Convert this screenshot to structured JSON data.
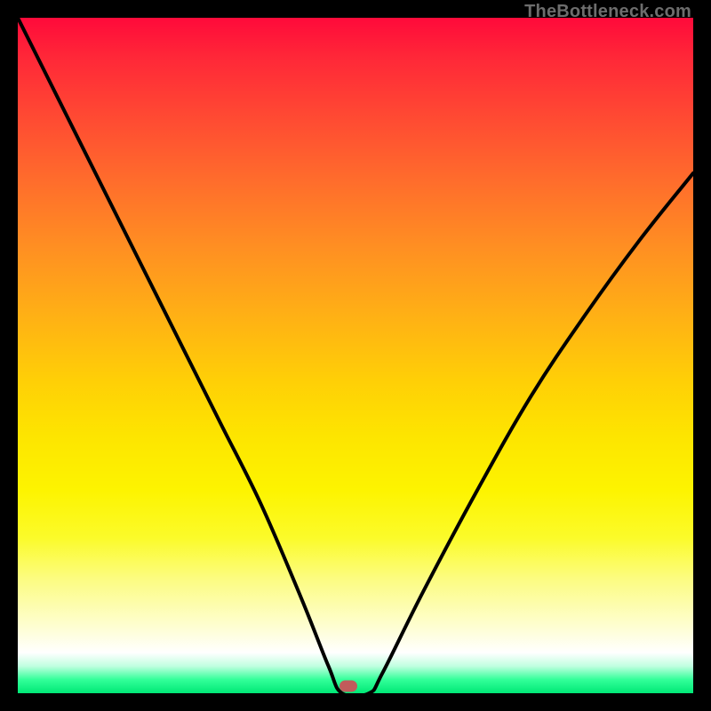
{
  "watermark": "TheBottleneck.com",
  "chart_data": {
    "type": "line",
    "title": "",
    "xlabel": "",
    "ylabel": "",
    "xlim": [
      0,
      100
    ],
    "ylim": [
      0,
      100
    ],
    "grid": false,
    "annotations": [
      {
        "name": "optimum-marker",
        "x": 49,
        "y": 1
      }
    ],
    "series": [
      {
        "name": "bottleneck-curve",
        "x": [
          0,
          6,
          12,
          18,
          24,
          30,
          36,
          42,
          46,
          48,
          52,
          54,
          60,
          68,
          76,
          84,
          92,
          100
        ],
        "y": [
          100,
          88,
          76,
          64,
          52,
          40,
          28,
          14,
          4,
          0,
          0,
          3,
          15,
          30,
          44,
          56,
          67,
          77
        ]
      }
    ]
  },
  "colors": {
    "curve_stroke": "#000000",
    "marker_fill": "#c15b5b"
  },
  "plot": {
    "inner_size": 760,
    "offset": 20
  }
}
